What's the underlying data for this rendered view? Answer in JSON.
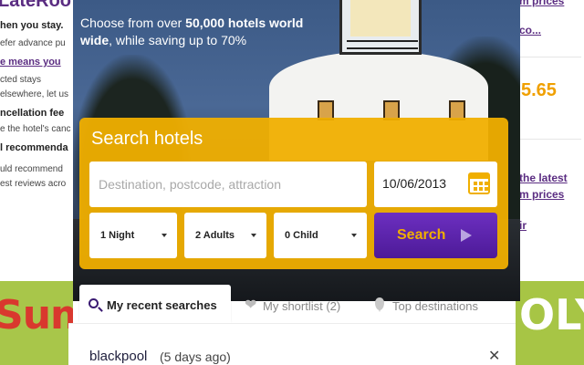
{
  "background_left": {
    "logo": "LateRoo",
    "lines": [
      "hen you stay.",
      "efer advance pu",
      "e means you",
      "cted stays",
      "elsewhere, let us",
      "ncellation fee",
      "e the hotel's canc",
      "l recommenda",
      "uld recommend",
      "est reviews acro"
    ]
  },
  "background_right": {
    "link1": "m prices",
    "link2": "co...",
    "price": "5.65",
    "link3": "the latest",
    "link4": "m prices",
    "link5": "ir"
  },
  "banners": {
    "left_text": "Sum",
    "right_text": "OLY"
  },
  "hero": {
    "tagline_prefix": "Choose from over ",
    "tagline_bold": "50,000 hotels world wide",
    "tagline_suffix": ", while saving up to 70%"
  },
  "search": {
    "title": "Search hotels",
    "destination_placeholder": "Destination, postcode, attraction",
    "date_value": "10/06/2013",
    "nights": "1 Night",
    "adults": "2 Adults",
    "children": "0 Child",
    "button_label": "Search"
  },
  "tabs": {
    "recent": "My recent searches",
    "shortlist": "My shortlist (2)",
    "destinations": "Top destinations"
  },
  "recent_searches": [
    {
      "place": "blackpool",
      "ago": "(5 days ago)"
    }
  ],
  "colors": {
    "accent_yellow": "#f0af00",
    "brand_purple": "#5b2d82"
  }
}
